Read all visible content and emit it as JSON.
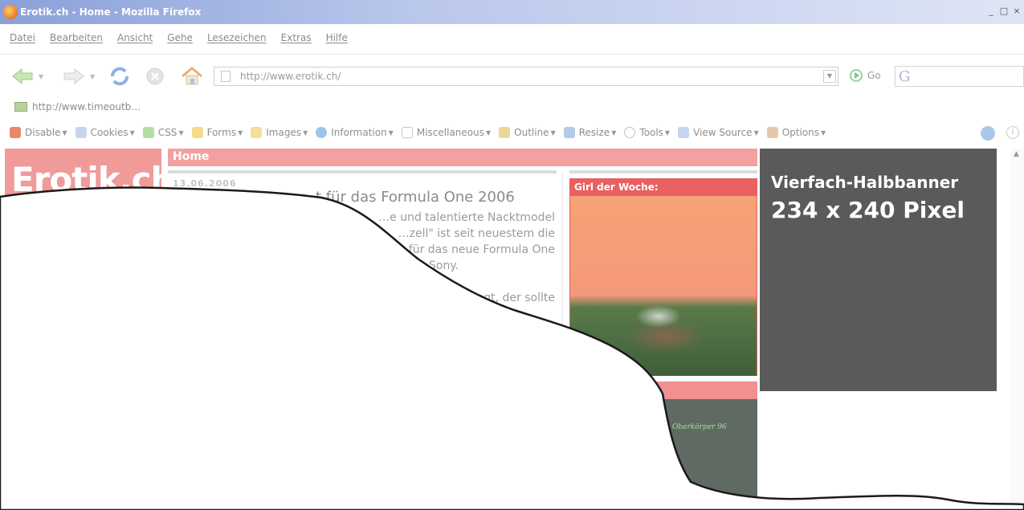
{
  "window": {
    "title": "Erotik.ch - Home - Mozilla Firefox",
    "controls": [
      "_",
      "□",
      "×"
    ]
  },
  "menu": [
    "Datei",
    "Bearbeiten",
    "Ansicht",
    "Gehe",
    "Lesezeichen",
    "Extras",
    "Hilfe"
  ],
  "navbar": {
    "url": "http://www.erotik.ch/",
    "go_label": "Go",
    "search_letter": "G"
  },
  "bookmarks": [
    {
      "label": "http://www.timeoutb…",
      "icon": "bookmark-favicon"
    }
  ],
  "devtoolbar": {
    "items": [
      {
        "label": "Disable",
        "icon": "disable-icon",
        "color": "#e8866a"
      },
      {
        "label": "Cookies",
        "icon": "cookies-icon",
        "color": "#c9d6ea"
      },
      {
        "label": "CSS",
        "icon": "css-icon",
        "color": "#b7dca4"
      },
      {
        "label": "Forms",
        "icon": "forms-icon",
        "color": "#f3db8a"
      },
      {
        "label": "Images",
        "icon": "images-icon",
        "color": "#f1df9a"
      },
      {
        "label": "Information",
        "icon": "information-icon",
        "color": "#9fc4ea"
      },
      {
        "label": "Miscellaneous",
        "icon": "miscellaneous-icon",
        "color": "#d7d7d7"
      },
      {
        "label": "Outline",
        "icon": "outline-icon",
        "color": "#e8d89a"
      },
      {
        "label": "Resize",
        "icon": "resize-icon",
        "color": "#b6c9e6"
      },
      {
        "label": "Tools",
        "icon": "tools-icon",
        "color": "#d0d0d0"
      },
      {
        "label": "View Source",
        "icon": "view-source-icon",
        "color": "#c5d6ec"
      },
      {
        "label": "Options",
        "icon": "options-icon",
        "color": "#e6c8a8"
      }
    ]
  },
  "page": {
    "logo": "Erotik.ch",
    "section_title": "Home",
    "article": {
      "date": "13.06.2006",
      "headline": "…t für das Formula One 2006",
      "lines": [
        "…e und talentierte Nacktmodel",
        "…zell\" ist seit neuestem die",
        "…für das neue Formula One",
        "…Sony.",
        "",
        "…agt, der sollte"
      ]
    },
    "girl_box": {
      "label": "Girl der Woche:"
    },
    "second_box": {
      "label": ":",
      "image_text": "Oberkörper 96"
    },
    "banner": {
      "line1": "Vierfach-Halbbanner",
      "line2": "234 x 240 Pixel"
    }
  }
}
